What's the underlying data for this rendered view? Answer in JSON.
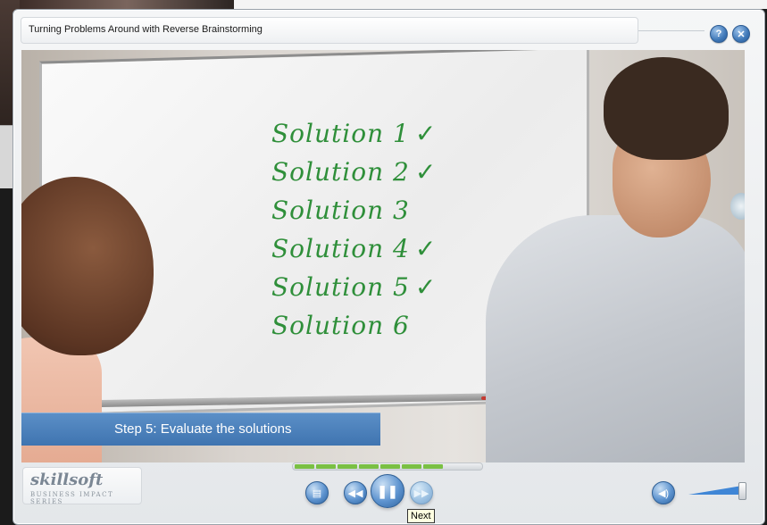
{
  "window": {
    "title": "Turning Problems Around with Reverse Brainstorming",
    "help_icon": "question-mark",
    "close_icon": "x"
  },
  "video": {
    "whiteboard_lines": [
      {
        "text": "Solution 1",
        "check": "✓"
      },
      {
        "text": "Solution 2",
        "check": "✓"
      },
      {
        "text": "Solution 3",
        "check": ""
      },
      {
        "text": "Solution 4",
        "check": "✓"
      },
      {
        "text": "Solution 5",
        "check": "✓"
      },
      {
        "text": "Solution 6",
        "check": ""
      }
    ],
    "step_caption": "Step 5: Evaluate the solutions"
  },
  "branding": {
    "logo_text": "skillsoft",
    "logo_subtitle": "BUSINESS IMPACT SERIES"
  },
  "controls": {
    "progress_completed_segments": 7,
    "progress_total_segments": 8,
    "notes_icon": "notes",
    "rewind_icon": "rewind",
    "pause_icon": "pause",
    "next_icon": "fast-forward",
    "next_tooltip": "Next",
    "audio_icon": "speaker",
    "volume_level": 1.0
  },
  "colors": {
    "accent": "#3f74b0",
    "progress": "#7ac043",
    "marker": "#2f8f3a"
  }
}
